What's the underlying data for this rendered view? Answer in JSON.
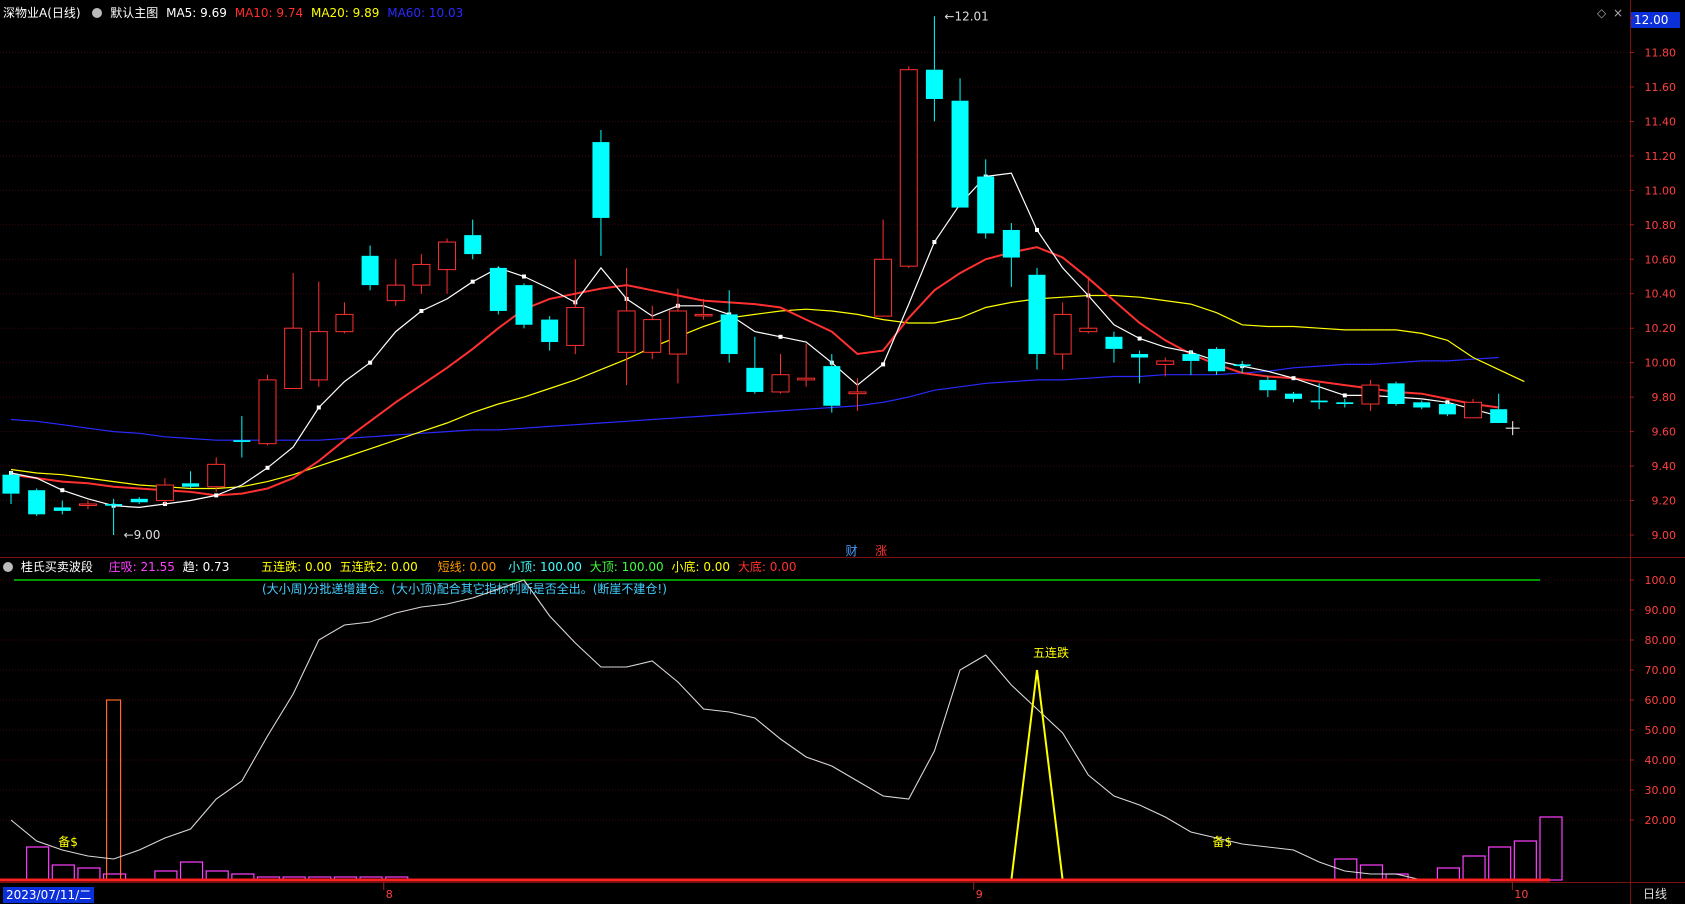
{
  "header": {
    "stock_name": "深物业A",
    "period": "(日线)",
    "template": "默认主图",
    "ma": [
      {
        "label": "MA5:",
        "value": "9.69",
        "color": "#ffffff"
      },
      {
        "label": "MA10:",
        "value": "9.74",
        "color": "#ff3030"
      },
      {
        "label": "MA20:",
        "value": "9.89",
        "color": "#ffff00"
      },
      {
        "label": "MA60:",
        "value": "10.03",
        "color": "#2a2aff"
      }
    ],
    "price_tag": "12.00"
  },
  "sub_header": {
    "indicator_name": "桂氏买卖波段",
    "items": [
      {
        "label": "庄吸:",
        "value": "21.55",
        "color": "#ff40ff"
      },
      {
        "label": "趋:",
        "value": "0.73",
        "color": "#ffffff"
      },
      {
        "label": "五连跌:",
        "value": "0.00",
        "color": "#ffff00"
      },
      {
        "label": "五连跌2:",
        "value": "0.00",
        "color": "#ffff00"
      },
      {
        "label": "短线:",
        "value": "0.00",
        "color": "#ff9900"
      },
      {
        "label": "小顶:",
        "value": "100.00",
        "color": "#40ffff"
      },
      {
        "label": "大顶:",
        "value": "100.00",
        "color": "#40ff40"
      },
      {
        "label": "小底:",
        "value": "0.00",
        "color": "#ffff00"
      },
      {
        "label": "大底:",
        "value": "0.00",
        "color": "#ff3030"
      }
    ],
    "note": "(大小周)分批递增建仓。(大小顶)配合其它指标判断是否全出。(断崖不建仓!)"
  },
  "bottom": {
    "date_label": "2023/07/11/二",
    "month_labels": [
      "8",
      "9",
      "10"
    ],
    "period_label": "日线"
  },
  "chart_data": [
    {
      "type": "candlestick",
      "ylim": [
        8.9,
        12.05
      ],
      "y_ticks": [
        "12.00",
        "11.80",
        "11.60",
        "11.40",
        "11.20",
        "11.00",
        "10.80",
        "10.60",
        "10.40",
        "10.20",
        "10.00",
        "9.80",
        "9.60",
        "9.40",
        "9.20",
        "9.00"
      ],
      "candles": [
        {
          "o": 9.35,
          "c": 9.24,
          "h": 9.37,
          "l": 9.18
        },
        {
          "o": 9.26,
          "c": 9.12,
          "h": 9.27,
          "l": 9.11
        },
        {
          "o": 9.16,
          "c": 9.14,
          "h": 9.2,
          "l": 9.12
        },
        {
          "o": 9.18,
          "c": 9.18,
          "h": 9.2,
          "l": 9.15
        },
        {
          "o": 9.18,
          "c": 9.17,
          "h": 9.21,
          "l": 9.0
        },
        {
          "o": 9.21,
          "c": 9.19,
          "h": 9.22,
          "l": 9.18
        },
        {
          "o": 9.2,
          "c": 9.29,
          "h": 9.33,
          "l": 9.18
        },
        {
          "o": 9.3,
          "c": 9.28,
          "h": 9.37,
          "l": 9.27
        },
        {
          "o": 9.28,
          "c": 9.41,
          "h": 9.45,
          "l": 9.25
        },
        {
          "o": 9.55,
          "c": 9.54,
          "h": 9.69,
          "l": 9.45
        },
        {
          "o": 9.53,
          "c": 9.9,
          "h": 9.93,
          "l": 9.52
        },
        {
          "o": 9.85,
          "c": 10.2,
          "h": 10.52,
          "l": 9.85
        },
        {
          "o": 9.9,
          "c": 10.18,
          "h": 10.47,
          "l": 9.86
        },
        {
          "o": 10.18,
          "c": 10.28,
          "h": 10.35,
          "l": 10.17
        },
        {
          "o": 10.62,
          "c": 10.45,
          "h": 10.68,
          "l": 10.42
        },
        {
          "o": 10.36,
          "c": 10.45,
          "h": 10.6,
          "l": 10.33
        },
        {
          "o": 10.45,
          "c": 10.57,
          "h": 10.63,
          "l": 10.4
        },
        {
          "o": 10.54,
          "c": 10.7,
          "h": 10.72,
          "l": 10.4
        },
        {
          "o": 10.74,
          "c": 10.63,
          "h": 10.83,
          "l": 10.6
        },
        {
          "o": 10.55,
          "c": 10.3,
          "h": 10.56,
          "l": 10.28
        },
        {
          "o": 10.45,
          "c": 10.22,
          "h": 10.46,
          "l": 10.2
        },
        {
          "o": 10.25,
          "c": 10.12,
          "h": 10.27,
          "l": 10.07
        },
        {
          "o": 10.1,
          "c": 10.32,
          "h": 10.6,
          "l": 10.05
        },
        {
          "o": 11.28,
          "c": 10.84,
          "h": 11.35,
          "l": 10.62
        },
        {
          "o": 10.06,
          "c": 10.3,
          "h": 10.55,
          "l": 9.87
        },
        {
          "o": 10.06,
          "c": 10.25,
          "h": 10.33,
          "l": 10.02
        },
        {
          "o": 10.05,
          "c": 10.3,
          "h": 10.43,
          "l": 9.88
        },
        {
          "o": 10.28,
          "c": 10.28,
          "h": 10.37,
          "l": 10.25
        },
        {
          "o": 10.28,
          "c": 10.05,
          "h": 10.42,
          "l": 10.0
        },
        {
          "o": 9.97,
          "c": 9.83,
          "h": 10.15,
          "l": 9.82
        },
        {
          "o": 9.83,
          "c": 9.93,
          "h": 10.05,
          "l": 9.82
        },
        {
          "o": 9.9,
          "c": 9.91,
          "h": 10.11,
          "l": 9.86
        },
        {
          "o": 9.98,
          "c": 9.75,
          "h": 10.05,
          "l": 9.71
        },
        {
          "o": 9.82,
          "c": 9.83,
          "h": 9.91,
          "l": 9.72
        },
        {
          "o": 10.27,
          "c": 10.6,
          "h": 10.83,
          "l": 10.27
        },
        {
          "o": 10.56,
          "c": 11.7,
          "h": 11.72,
          "l": 10.55
        },
        {
          "o": 11.7,
          "c": 11.53,
          "h": 12.01,
          "l": 11.4
        },
        {
          "o": 11.52,
          "c": 10.9,
          "h": 11.65,
          "l": 10.9
        },
        {
          "o": 11.08,
          "c": 10.75,
          "h": 11.18,
          "l": 10.72
        },
        {
          "o": 10.77,
          "c": 10.61,
          "h": 10.81,
          "l": 10.44
        },
        {
          "o": 10.51,
          "c": 10.05,
          "h": 10.55,
          "l": 9.96
        },
        {
          "o": 10.05,
          "c": 10.28,
          "h": 10.35,
          "l": 9.96
        },
        {
          "o": 10.18,
          "c": 10.2,
          "h": 10.5,
          "l": 10.17
        },
        {
          "o": 10.15,
          "c": 10.08,
          "h": 10.18,
          "l": 10.0
        },
        {
          "o": 10.05,
          "c": 10.03,
          "h": 10.07,
          "l": 9.88
        },
        {
          "o": 9.99,
          "c": 10.01,
          "h": 10.03,
          "l": 9.92
        },
        {
          "o": 10.05,
          "c": 10.01,
          "h": 10.07,
          "l": 9.93
        },
        {
          "o": 10.08,
          "c": 9.95,
          "h": 10.09,
          "l": 9.93
        },
        {
          "o": 9.99,
          "c": 9.98,
          "h": 10.01,
          "l": 9.94
        },
        {
          "o": 9.9,
          "c": 9.84,
          "h": 9.92,
          "l": 9.8
        },
        {
          "o": 9.82,
          "c": 9.79,
          "h": 9.83,
          "l": 9.77
        },
        {
          "o": 9.78,
          "c": 9.77,
          "h": 9.88,
          "l": 9.73
        },
        {
          "o": 9.77,
          "c": 9.76,
          "h": 9.79,
          "l": 9.74
        },
        {
          "o": 9.76,
          "c": 9.87,
          "h": 9.9,
          "l": 9.72
        },
        {
          "o": 9.88,
          "c": 9.76,
          "h": 9.89,
          "l": 9.75
        },
        {
          "o": 9.77,
          "c": 9.74,
          "h": 9.78,
          "l": 9.73
        },
        {
          "o": 9.76,
          "c": 9.7,
          "h": 9.77,
          "l": 9.69
        },
        {
          "o": 9.68,
          "c": 9.77,
          "h": 9.79,
          "l": 9.68
        },
        {
          "o": 9.73,
          "c": 9.65,
          "h": 9.82,
          "l": 9.65
        }
      ],
      "series": [
        {
          "name": "MA5",
          "color": "#ffffff",
          "values": [
            9.36,
            9.33,
            9.26,
            9.21,
            9.17,
            9.16,
            9.18,
            9.2,
            9.23,
            9.29,
            9.39,
            9.51,
            9.74,
            9.89,
            10.0,
            10.18,
            10.3,
            10.37,
            10.47,
            10.55,
            10.5,
            10.43,
            10.35,
            10.55,
            10.37,
            10.27,
            10.33,
            10.33,
            10.28,
            10.18,
            10.15,
            10.12,
            10.0,
            9.87,
            9.99,
            10.34,
            10.7,
            10.92,
            11.08,
            11.1,
            10.77,
            10.55,
            10.39,
            10.22,
            10.14,
            10.09,
            10.06,
            10.01,
            9.98,
            9.95,
            9.91,
            9.86,
            9.81,
            9.81,
            9.8,
            9.79,
            9.77,
            9.73,
            9.69
          ]
        },
        {
          "name": "MA10",
          "color": "#ff3030",
          "values": [
            9.35,
            9.33,
            9.31,
            9.3,
            9.28,
            9.27,
            9.26,
            9.25,
            9.23,
            9.24,
            9.27,
            9.33,
            9.43,
            9.55,
            9.66,
            9.77,
            9.87,
            9.97,
            10.08,
            10.2,
            10.31,
            10.37,
            10.4,
            10.43,
            10.45,
            10.42,
            10.39,
            10.36,
            10.35,
            10.34,
            10.32,
            10.25,
            10.18,
            10.05,
            10.07,
            10.26,
            10.42,
            10.52,
            10.6,
            10.64,
            10.67,
            10.61,
            10.49,
            10.36,
            10.23,
            10.13,
            10.05,
            9.99,
            9.94,
            9.92,
            9.91,
            9.89,
            9.87,
            9.85,
            9.83,
            9.82,
            9.79,
            9.76,
            9.74
          ]
        },
        {
          "name": "MA20",
          "color": "#ffff00",
          "values": [
            9.38,
            9.36,
            9.35,
            9.33,
            9.31,
            9.29,
            9.28,
            9.27,
            9.27,
            9.28,
            9.31,
            9.35,
            9.4,
            9.45,
            9.5,
            9.55,
            9.6,
            9.65,
            9.71,
            9.76,
            9.8,
            9.85,
            9.9,
            9.96,
            10.02,
            10.09,
            10.15,
            10.21,
            10.26,
            10.28,
            10.3,
            10.31,
            10.3,
            10.28,
            10.25,
            10.23,
            10.23,
            10.26,
            10.32,
            10.35,
            10.37,
            10.38,
            10.39,
            10.39,
            10.38,
            10.36,
            10.34,
            10.29,
            10.22,
            10.21,
            10.21,
            10.2,
            10.19,
            10.19,
            10.19,
            10.17,
            10.13,
            10.03,
            9.96,
            9.89
          ]
        },
        {
          "name": "MA60",
          "color": "#2a2aff",
          "values": [
            9.67,
            9.66,
            9.64,
            9.62,
            9.6,
            9.59,
            9.57,
            9.56,
            9.55,
            9.55,
            9.55,
            9.55,
            9.55,
            9.56,
            9.57,
            9.58,
            9.59,
            9.6,
            9.61,
            9.61,
            9.62,
            9.63,
            9.64,
            9.65,
            9.66,
            9.67,
            9.68,
            9.69,
            9.7,
            9.71,
            9.72,
            9.73,
            9.74,
            9.75,
            9.77,
            9.8,
            9.84,
            9.86,
            9.88,
            9.89,
            9.9,
            9.9,
            9.91,
            9.92,
            9.92,
            9.93,
            9.93,
            9.93,
            9.94,
            9.95,
            9.97,
            9.98,
            9.99,
            9.99,
            10.0,
            10.01,
            10.01,
            10.02,
            10.03
          ]
        }
      ],
      "annotations": [
        {
          "text": "12.01",
          "candle": 36,
          "y": 12.01
        },
        {
          "text": "9.00",
          "candle": 4,
          "y": 9.0
        }
      ],
      "markers": [
        {
          "text": "财",
          "color": "#4a9eff",
          "candle": 33
        },
        {
          "text": "涨",
          "color": "#ff3030",
          "candle": 34
        }
      ]
    },
    {
      "type": "line",
      "ylim": [
        0,
        103
      ],
      "y_ticks": [
        "100.0",
        "90.00",
        "80.00",
        "70.00",
        "60.00",
        "50.00",
        "40.00",
        "30.00",
        "20.00"
      ],
      "reference_line": {
        "value": 100,
        "color": "#00cc00"
      },
      "series": [
        {
          "name": "趋",
          "color": "#d8d8d8",
          "values": [
            20,
            13,
            10,
            8,
            7,
            10,
            14,
            17,
            27,
            33,
            48,
            62,
            80,
            85,
            86,
            89,
            91,
            92,
            94,
            97,
            100,
            88,
            79,
            71,
            71,
            73,
            66,
            57,
            56,
            54,
            47,
            41,
            38,
            33,
            28,
            27,
            43,
            70,
            75,
            65,
            57,
            49,
            35,
            28,
            25,
            21,
            16,
            14,
            12,
            11,
            10,
            6,
            3,
            2,
            2,
            0,
            0,
            0,
            0,
            0
          ]
        },
        {
          "name": "五连跌",
          "color": "#ffff00",
          "values": [
            0,
            0,
            0,
            0,
            0,
            0,
            0,
            0,
            0,
            0,
            0,
            0,
            0,
            0,
            0,
            0,
            0,
            0,
            0,
            0,
            0,
            0,
            0,
            0,
            0,
            0,
            0,
            0,
            0,
            0,
            0,
            0,
            0,
            0,
            0,
            0,
            0,
            0,
            0,
            0,
            70,
            0,
            0,
            0,
            0,
            0,
            0,
            0,
            0,
            0,
            0,
            0,
            0,
            0,
            0,
            0,
            0,
            0,
            0,
            0
          ]
        }
      ],
      "boxes_magenta": [
        0,
        11,
        5,
        4,
        2,
        0,
        3,
        6,
        3,
        2,
        1,
        1,
        1,
        1,
        1,
        1,
        0,
        0,
        0,
        0,
        0,
        0,
        0,
        0,
        0,
        0,
        0,
        0,
        0,
        0,
        0,
        0,
        0,
        0,
        0,
        0,
        0,
        0,
        0,
        0,
        0,
        0,
        0,
        0,
        0,
        0,
        0,
        0,
        0,
        0,
        0,
        0,
        7,
        5,
        2,
        0,
        4,
        8,
        11,
        13,
        21
      ],
      "box_magenta_start_index": [
        0,
        0,
        0,
        0,
        0,
        0,
        0,
        0,
        0,
        0,
        0,
        0,
        0,
        0,
        0,
        0,
        0,
        0,
        0,
        0,
        0,
        0,
        0,
        0,
        0,
        0,
        0,
        0,
        0,
        0,
        0,
        0,
        0,
        0,
        0,
        0,
        0,
        0,
        0,
        0,
        0,
        0,
        0,
        0,
        0,
        0,
        0,
        0,
        0,
        0,
        0,
        0,
        0,
        0,
        0,
        0,
        0,
        0,
        0,
        0
      ],
      "tall_bar": {
        "candle": 4,
        "value": 60,
        "color": "#ff6a2a"
      },
      "labels": [
        {
          "text": "备$",
          "candle": 2,
          "y": 10,
          "color": "#ffff00"
        },
        {
          "text": "五连跌",
          "candle": 40,
          "y": 73,
          "color": "#ffff00"
        },
        {
          "text": "备$",
          "candle": 47,
          "y": 10,
          "color": "#ffff00"
        }
      ]
    }
  ]
}
